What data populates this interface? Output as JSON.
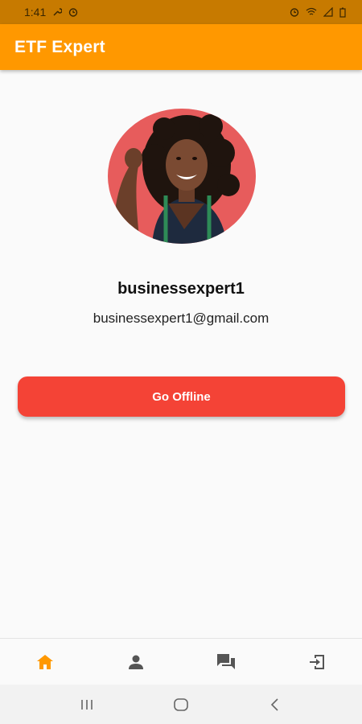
{
  "status_bar": {
    "time": "1:41",
    "left_icons": [
      "wrench-icon",
      "alarm-icon"
    ],
    "right_icons": [
      "alarm-icon",
      "wifi-icon",
      "signal-icon",
      "battery-icon"
    ]
  },
  "app_bar": {
    "title": "ETF Expert",
    "color": "#ff9800"
  },
  "profile": {
    "avatar_icon": "profile-photo",
    "username": "businessexpert1",
    "email": "businessexpert1@gmail.com"
  },
  "actions": {
    "offline_label": "Go Offline",
    "offline_color": "#f44336"
  },
  "bottom_nav": {
    "items": [
      {
        "icon": "home-icon",
        "active": true
      },
      {
        "icon": "person-icon",
        "active": false
      },
      {
        "icon": "chat-icon",
        "active": false
      },
      {
        "icon": "logout-icon",
        "active": false
      }
    ],
    "active_color": "#ff9800",
    "inactive_color": "#555555"
  },
  "system_nav": {
    "buttons": [
      "recents-icon",
      "home-circle-icon",
      "back-icon"
    ]
  }
}
